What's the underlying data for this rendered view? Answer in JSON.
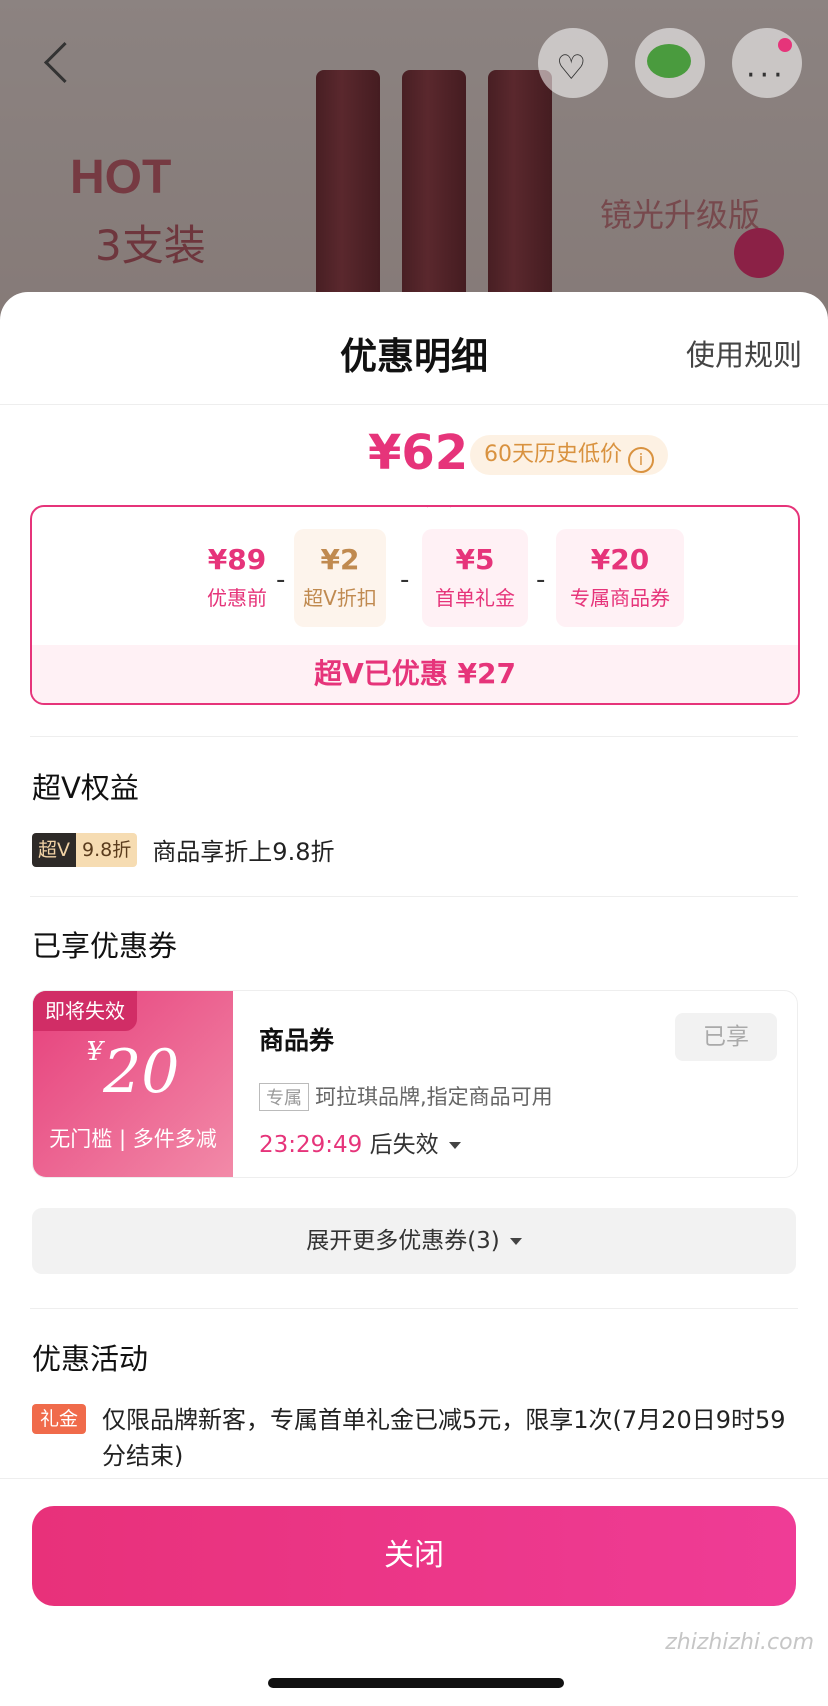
{
  "sheet": {
    "title": "优惠明细",
    "rules_label": "使用规则"
  },
  "price": {
    "final": "¥62",
    "history_badge": "60天历史低价"
  },
  "breakdown": {
    "items": [
      {
        "value": "¥89",
        "label": "优惠前"
      },
      {
        "value": "¥2",
        "label": "超V折扣"
      },
      {
        "value": "¥5",
        "label": "首单礼金"
      },
      {
        "value": "¥20",
        "label": "专属商品券"
      }
    ],
    "separator": "-",
    "total_label": "超V已优惠 ¥27"
  },
  "vip": {
    "section_title": "超V权益",
    "tag_dark": "超V",
    "tag_light": "9.8折",
    "text": "商品享折上9.8折"
  },
  "coupons": {
    "section_title": "已享优惠券",
    "coupon": {
      "expire_badge": "即将失效",
      "currency": "¥",
      "amount": "20",
      "condition": "无门槛 | 多件多减",
      "name": "商品券",
      "status": "已享",
      "scope_tag": "专属",
      "scope_text": "珂拉琪品牌,指定商品可用",
      "timer": "23:29:49",
      "timer_suffix": "后失效"
    },
    "expand_label": "展开更多优惠券(3)"
  },
  "activities": {
    "section_title": "优惠活动",
    "tag": "礼金",
    "text": "仅限品牌新客，专属首单礼金已减5元，限享1次(7月20日9时59分结束)"
  },
  "close_label": "关闭",
  "background": {
    "hot_title": "HOT",
    "hot_sub": "3支装",
    "right_text": "镜光升级版"
  },
  "watermark": "zhizhizhi.com",
  "colors": {
    "accent": "#e6347a",
    "vip_gold": "#c08a50"
  }
}
